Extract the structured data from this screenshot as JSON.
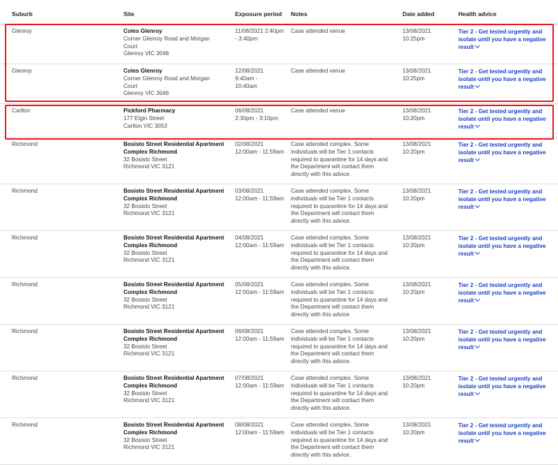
{
  "headers": {
    "suburb": "Suburb",
    "site": "Site",
    "exposure": "Exposure period",
    "notes": "Notes",
    "date_added": "Date added",
    "health_advice": "Health advice"
  },
  "rows": [
    {
      "suburb": "Glenroy",
      "site_name": "Coles Glenroy",
      "site_address": [
        "Corner Glenroy Road and Morgan",
        "Court",
        "Glenroy VIC 3046"
      ],
      "exposure": [
        "11/08/2021 2:40pm",
        "- 3:40pm"
      ],
      "notes": [
        "Case attended venue"
      ],
      "date_added": [
        "13/08/2021",
        "10:25pm"
      ],
      "advice": [
        "Tier 2 - Get tested urgently and",
        "isolate until you have a negative",
        "result"
      ],
      "highlighted": true
    },
    {
      "suburb": "Glenroy",
      "site_name": "Coles Glenroy",
      "site_address": [
        "Corner Glenroy Road and Morgan",
        "Court",
        "Glenroy VIC 3046"
      ],
      "exposure": [
        "12/08/2021",
        "9:40am -",
        "10:40am"
      ],
      "notes": [
        "Case attended venue"
      ],
      "date_added": [
        "13/08/2021",
        "10:25pm"
      ],
      "advice": [
        "Tier 2 - Get tested urgently and",
        "isolate until you have a negative",
        "result"
      ],
      "highlighted": true
    },
    {
      "suburb": "Carlton",
      "site_name": "Pickford Pharmacy",
      "site_address": [
        "177 Elgin Street",
        "Carlton VIC 3053"
      ],
      "exposure": [
        "06/08/2021",
        "2:30pm - 3:10pm"
      ],
      "notes": [
        "Case attended venue"
      ],
      "date_added": [
        "13/08/2021",
        "10:20pm"
      ],
      "advice": [
        "Tier 2 - Get tested urgently and",
        "isolate until you have a negative",
        "result"
      ],
      "highlighted": true
    },
    {
      "suburb": "Richmond",
      "site_name": "Bosisto Street Residential Apartment Complex Richmond",
      "site_name_lines": [
        "Bosisto Street Residential Apartment",
        "Complex Richmond"
      ],
      "site_address": [
        "32 Bosisto Street",
        "Richmond VIC 3121"
      ],
      "exposure": [
        "02/08/2021",
        "12:00am - 11:59am"
      ],
      "notes": [
        "Case attended complex. Some",
        "individuals will be Tier 1 contacts",
        "required to quarantine for 14 days and",
        "the Department will contact them",
        "directly with this advice."
      ],
      "date_added": [
        "13/08/2021",
        "10:20pm"
      ],
      "advice": [
        "Tier 2 - Get tested urgently and",
        "isolate until you have a negative",
        "result"
      ],
      "highlighted": false
    },
    {
      "suburb": "Richmond",
      "site_name": "Bosisto Street Residential Apartment Complex Richmond",
      "site_name_lines": [
        "Bosisto Street Residential Apartment",
        "Complex Richmond"
      ],
      "site_address": [
        "32 Bosisto Street",
        "Richmond VIC 3121"
      ],
      "exposure": [
        "03/08/2021",
        "12:00am - 11:59am"
      ],
      "notes": [
        "Case attended complex. Some",
        "individuals will be Tier 1 contacts",
        "required to quarantine for 14 days and",
        "the Department will contact them",
        "directly with this advice."
      ],
      "date_added": [
        "13/08/2021",
        "10:20pm"
      ],
      "advice": [
        "Tier 2 - Get tested urgently and",
        "isolate until you have a negative",
        "result"
      ],
      "highlighted": false
    },
    {
      "suburb": "Richmond",
      "site_name": "Bosisto Street Residential Apartment Complex Richmond",
      "site_name_lines": [
        "Bosisto Street Residential Apartment",
        "Complex Richmond"
      ],
      "site_address": [
        "32 Bosisto Street",
        "Richmond VIC 3121"
      ],
      "exposure": [
        "04/08/2021",
        "12:00am - 11:59am"
      ],
      "notes": [
        "Case attended complex. Some",
        "individuals will be Tier 1 contacts",
        "required to quarantine for 14 days and",
        "the Department will contact them",
        "directly with this advice."
      ],
      "date_added": [
        "13/08/2021",
        "10:20pm"
      ],
      "advice": [
        "Tier 2 - Get tested urgently and",
        "isolate until you have a negative",
        "result"
      ],
      "highlighted": false
    },
    {
      "suburb": "Richmond",
      "site_name": "Bosisto Street Residential Apartment Complex Richmond",
      "site_name_lines": [
        "Bosisto Street Residential Apartment",
        "Complex Richmond"
      ],
      "site_address": [
        "32 Bosisto Street",
        "Richmond VIC 3121"
      ],
      "exposure": [
        "05/08/2021",
        "12:00am - 11:59am"
      ],
      "notes": [
        "Case attended complex. Some",
        "individuals will be Tier 1 contacts",
        "required to quarantine for 14 days and",
        "the Department will contact them",
        "directly with this advice."
      ],
      "date_added": [
        "13/08/2021",
        "10:20pm"
      ],
      "advice": [
        "Tier 2 - Get tested urgently and",
        "isolate until you have a negative",
        "result"
      ],
      "highlighted": false
    },
    {
      "suburb": "Richmond",
      "site_name": "Bosisto Street Residential Apartment Complex Richmond",
      "site_name_lines": [
        "Bosisto Street Residential Apartment",
        "Complex Richmond"
      ],
      "site_address": [
        "32 Bosisto Street",
        "Richmond VIC 3121"
      ],
      "exposure": [
        "06/08/2021",
        "12:00am - 11:59am"
      ],
      "notes": [
        "Case attended complex. Some",
        "individuals will be Tier 1 contacts",
        "required to quarantine for 14 days and",
        "the Department will contact them",
        "directly with this advice."
      ],
      "date_added": [
        "13/08/2021",
        "10:20pm"
      ],
      "advice": [
        "Tier 2 - Get tested urgently and",
        "isolate until you have a negative",
        "result"
      ],
      "highlighted": false
    },
    {
      "suburb": "Richmond",
      "site_name": "Bosisto Street Residential Apartment Complex Richmond",
      "site_name_lines": [
        "Bosisto Street Residential Apartment",
        "Complex Richmond"
      ],
      "site_address": [
        "32 Bosisto Street",
        "Richmond VIC 3121"
      ],
      "exposure": [
        "07/08/2021",
        "12:00am - 11:59am"
      ],
      "notes": [
        "Case attended complex. Some",
        "individuals will be Tier 1 contacts",
        "required to quarantine for 14 days and",
        "the Department will contact them",
        "directly with this advice."
      ],
      "date_added": [
        "13/08/2021",
        "10:20pm"
      ],
      "advice": [
        "Tier 2 - Get tested urgently and",
        "isolate until you have a negative",
        "result"
      ],
      "highlighted": false
    },
    {
      "suburb": "Richmond",
      "site_name": "Bosisto Street Residential Apartment Complex Richmond",
      "site_name_lines": [
        "Bosisto Street Residential Apartment",
        "Complex Richmond"
      ],
      "site_address": [
        "32 Bosisto Street",
        "Richmond VIC 3121"
      ],
      "exposure": [
        "08/08/2021",
        "12:00am - 11:59am"
      ],
      "notes": [
        "Case attended complex. Some",
        "individuals will be Tier 1 contacts",
        "required to quarantine for 14 days and",
        "the Department will contact them",
        "directly with this advice."
      ],
      "date_added": [
        "13/08/2021",
        "10:20pm"
      ],
      "advice": [
        "Tier 2 - Get tested urgently and",
        "isolate until you have a negative",
        "result"
      ],
      "highlighted": false
    }
  ],
  "colors": {
    "advice_link": "#1a3fc4",
    "highlight_border": "#e8141b"
  },
  "icons": {
    "advice_expand": "chevron-down-icon"
  }
}
